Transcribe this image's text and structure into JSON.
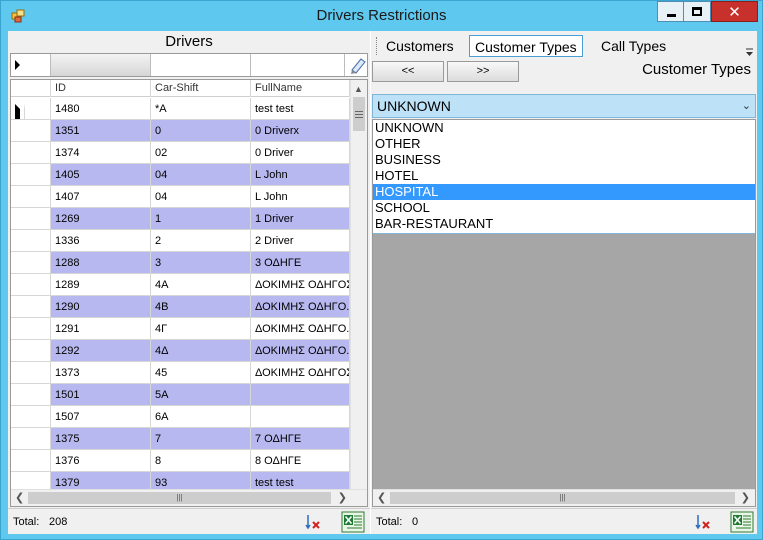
{
  "window": {
    "title": "Drivers Restrictions",
    "close_glyph": "✕"
  },
  "left": {
    "title": "Drivers",
    "columns": [
      "ID",
      "Car-Shift",
      "FullName"
    ],
    "rows": [
      {
        "id": "1480",
        "shift": "*A",
        "name": "test test"
      },
      {
        "id": "1351",
        "shift": "0",
        "name": "0 Driverx"
      },
      {
        "id": "1374",
        "shift": "02",
        "name": "0 Driver"
      },
      {
        "id": "1405",
        "shift": "04",
        "name": "L John"
      },
      {
        "id": "1407",
        "shift": "04",
        "name": "L John"
      },
      {
        "id": "1269",
        "shift": "1",
        "name": "1 Driver"
      },
      {
        "id": "1336",
        "shift": "2",
        "name": "2 Driver"
      },
      {
        "id": "1288",
        "shift": "3",
        "name": "3 ΟΔΗΓΕ"
      },
      {
        "id": "1289",
        "shift": "4A",
        "name": "ΔΟΚΙΜΗΣ ΟΔΗΓΟΣ"
      },
      {
        "id": "1290",
        "shift": "4B",
        "name": "ΔΟΚΙΜΗΣ ΟΔΗΓΟ..."
      },
      {
        "id": "1291",
        "shift": "4Γ",
        "name": "ΔΟΚΙΜΗΣ ΟΔΗΓΟ..."
      },
      {
        "id": "1292",
        "shift": "4Δ",
        "name": "ΔΟΚΙΜΗΣ ΟΔΗΓΟ..."
      },
      {
        "id": "1373",
        "shift": "45",
        "name": "ΔΟΚΙΜΗΣ ΟΔΗΓΟΣ"
      },
      {
        "id": "1501",
        "shift": "5A",
        "name": ""
      },
      {
        "id": "1507",
        "shift": "6A",
        "name": ""
      },
      {
        "id": "1375",
        "shift": "7",
        "name": "7 ΟΔΗΓΕ"
      },
      {
        "id": "1376",
        "shift": "8",
        "name": "8 ΟΔΗΓΕ"
      },
      {
        "id": "1379",
        "shift": "93",
        "name": "test test"
      }
    ],
    "footer": {
      "label": "Total:",
      "value": "208"
    }
  },
  "right": {
    "tabs": [
      "Customers",
      "Customer Types",
      "Call Types"
    ],
    "active_tab": "Customer Types",
    "prev_label": "<<",
    "next_label": ">>",
    "title": "Customer Types",
    "combo_value": "UNKNOWN",
    "options": [
      "UNKNOWN",
      "OTHER",
      "BUSINESS",
      "HOTEL",
      "HOSPITAL",
      "SCHOOL",
      "BAR-RESTAURANT"
    ],
    "selected_option": "HOSPITAL",
    "footer": {
      "label": "Total:",
      "value": "0"
    }
  },
  "colors": {
    "titlebar": "#5fc8ee",
    "alt_row": "#b8b8f0",
    "selection": "#3399ff",
    "combo": "#bde1f6",
    "close": "#c7302b"
  }
}
